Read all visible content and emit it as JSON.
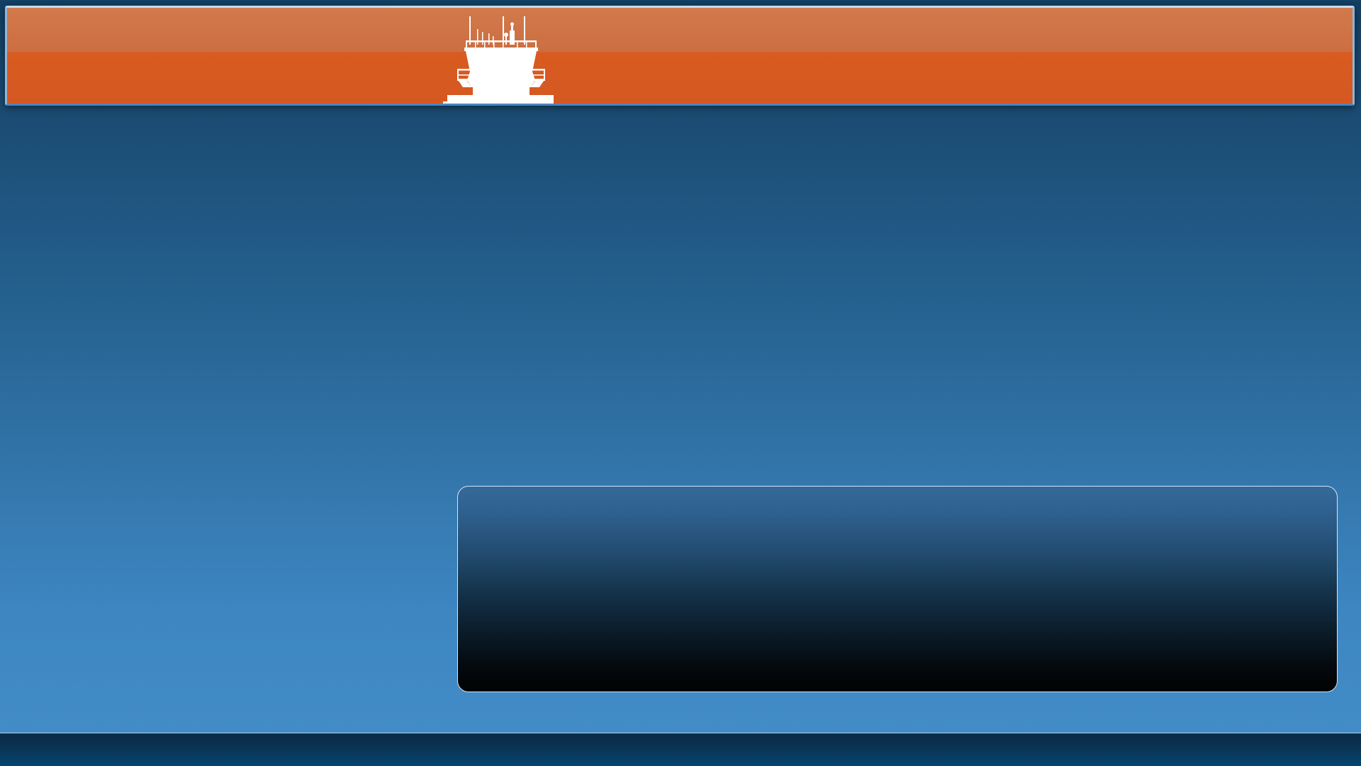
{
  "header": {
    "logo": "control-tower-icon",
    "colors": {
      "accent": "#d85b20",
      "accent_light": "#d27a4c",
      "border": "#8fb6d8"
    }
  },
  "info_panel": {
    "colors": {
      "top": "#34699a",
      "bottom": "#010203",
      "border": "#d6e4f2"
    }
  },
  "background": {
    "colors": {
      "top": "#123f62",
      "bottom": "#438dc9"
    }
  },
  "footer": {
    "colors": {
      "top": "#0b2a45",
      "bottom": "#054676"
    }
  }
}
